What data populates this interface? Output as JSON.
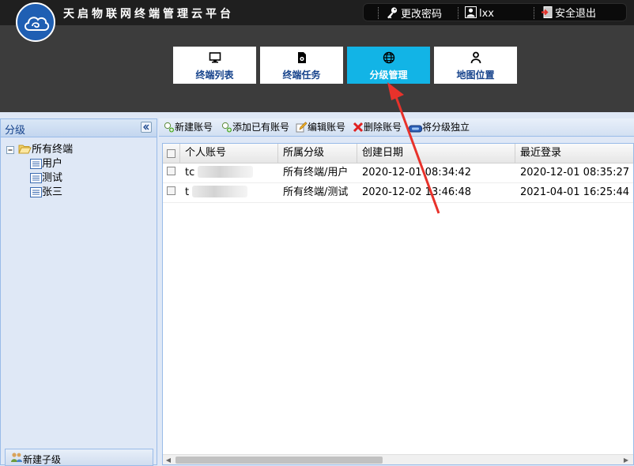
{
  "header": {
    "title": "天启物联网终端管理云平台",
    "user_bar": {
      "change_password": "更改密码",
      "username": "lxx",
      "logout": "安全退出"
    }
  },
  "nav": {
    "tiles": [
      {
        "label": "终端列表",
        "icon": "monitor-icon",
        "active": false
      },
      {
        "label": "终端任务",
        "icon": "task-doc-icon",
        "active": false
      },
      {
        "label": "分级管理",
        "icon": "globe-icon",
        "active": true
      },
      {
        "label": "地图位置",
        "icon": "person-icon",
        "active": false
      }
    ]
  },
  "left_panel": {
    "title": "分级",
    "tree": {
      "root": "所有终端",
      "children": [
        "用户",
        "测试",
        "张三"
      ]
    },
    "footer_button": "新建子级"
  },
  "toolbar": {
    "new_account": "新建账号",
    "add_existing": "添加已有账号",
    "edit_account": "编辑账号",
    "delete_account": "删除账号",
    "make_independent": "将分级独立"
  },
  "grid": {
    "columns": [
      "个人账号",
      "所属分级",
      "创建日期",
      "最近登录"
    ],
    "rows": [
      {
        "account": "tc",
        "group": "所有终端/用户",
        "created": "2020-12-01 08:34:42",
        "last_login": "2020-12-01 08:35:27"
      },
      {
        "account": "t",
        "group": "所有终端/测试",
        "created": "2020-12-02 13:46:48",
        "last_login": "2021-04-01 16:25:44"
      }
    ]
  },
  "colors": {
    "header_bg": "#3c3c3c",
    "active_tile": "#12b4e6",
    "nav_label": "#15428b",
    "panel_border": "#99bbe8",
    "annotation_arrow": "#e8322b"
  }
}
